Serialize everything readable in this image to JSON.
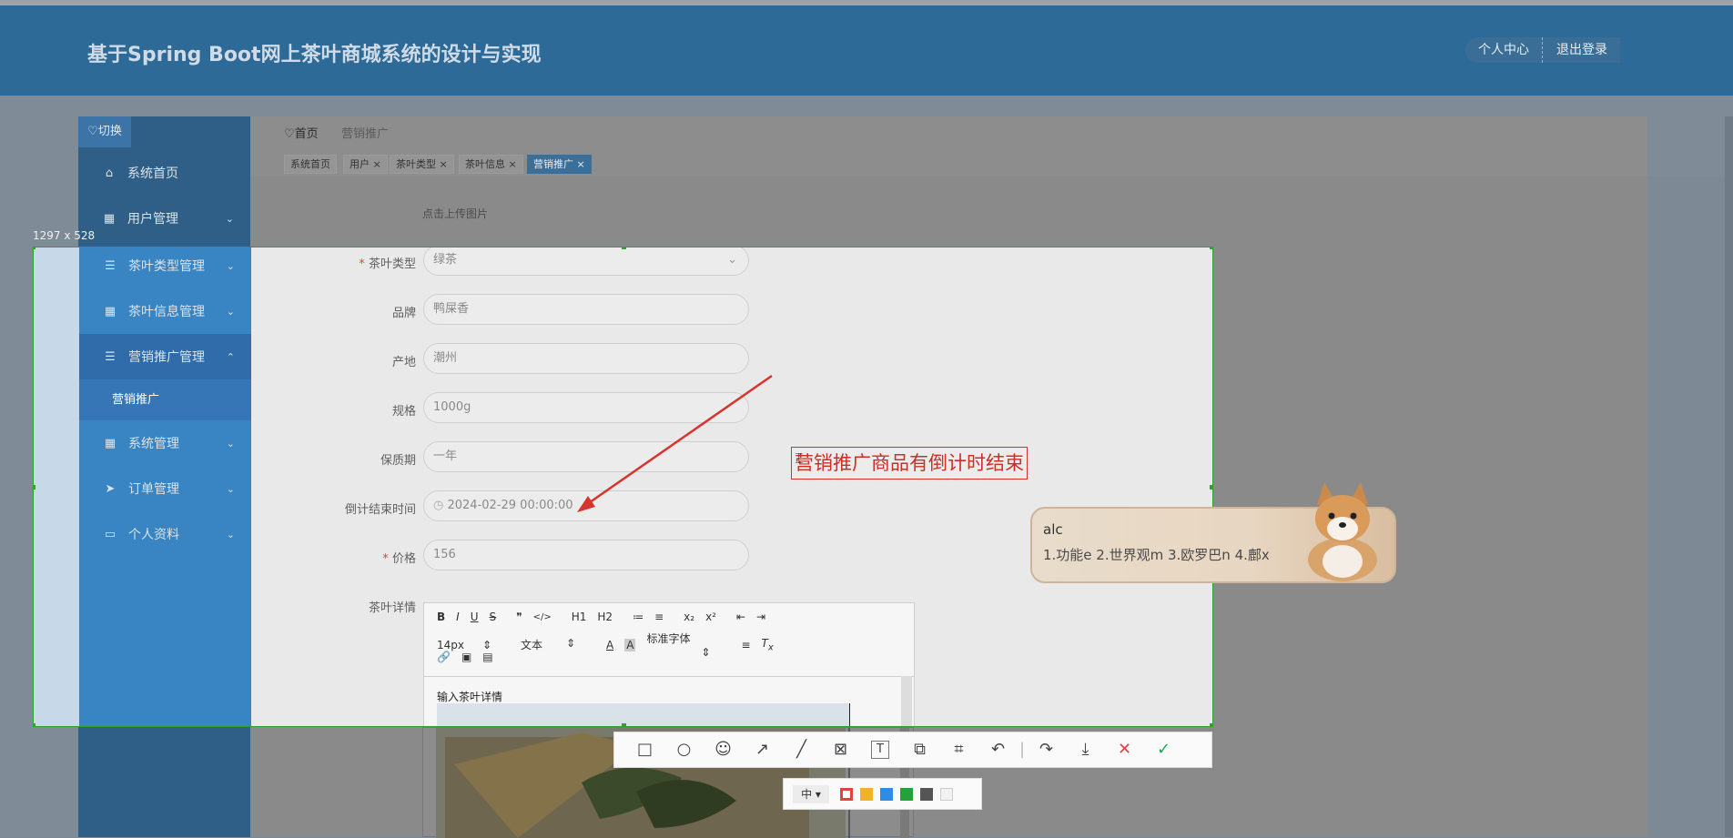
{
  "header": {
    "title": "基于Spring Boot网上茶叶商城系统的设计与实现",
    "personal_center": "个人中心",
    "logout": "退出登录"
  },
  "sidebar": {
    "toggle": "♡切换",
    "items": [
      {
        "label": "系统首页",
        "icon": "home-icon"
      },
      {
        "label": "用户管理",
        "icon": "grid-icon"
      },
      {
        "label": "茶叶类型管理",
        "icon": "list-icon"
      },
      {
        "label": "茶叶信息管理",
        "icon": "grid-icon"
      },
      {
        "label": "营销推广管理",
        "icon": "list-icon"
      },
      {
        "label": "系统管理",
        "icon": "apps-icon"
      },
      {
        "label": "订单管理",
        "icon": "send-icon"
      },
      {
        "label": "个人资料",
        "icon": "card-icon"
      }
    ],
    "sub_item": "营销推广"
  },
  "breadcrumb": {
    "home": "♡首页",
    "current": "营销推广"
  },
  "tabs": [
    "系统首页",
    "用户",
    "茶叶类型",
    "茶叶信息",
    "营销推广"
  ],
  "form": {
    "upload_hint": "点击上传图片",
    "fields": [
      {
        "label": "茶叶类型",
        "value": "绿茶",
        "required": true
      },
      {
        "label": "品牌",
        "value": "鸭屎香",
        "required": false
      },
      {
        "label": "产地",
        "value": "潮州",
        "required": false
      },
      {
        "label": "规格",
        "value": "1000g",
        "required": false
      },
      {
        "label": "保质期",
        "value": "一年",
        "required": false
      },
      {
        "label": "倒计结束时间",
        "value": "2024-02-29 00:00:00",
        "required": false
      },
      {
        "label": "价格",
        "value": "156",
        "required": true
      }
    ],
    "detail_label": "茶叶详情",
    "editor": {
      "toolbar_row1": [
        "B",
        "I",
        "U",
        "S",
        "❞",
        "</>",
        "H1",
        "H2",
        "≔",
        "≡",
        "x₂",
        "x²",
        "⇤",
        "⇥"
      ],
      "font_size": "14px",
      "text_type": "文本",
      "font_family": "标准字体",
      "placeholder_text": "输入茶叶详情"
    }
  },
  "screenshot": {
    "size_label": "1297 x 528",
    "annotation_text": "营销推广商品有倒计时结束",
    "ime_input": "alc",
    "ime_candidates": "1.功能e  2.世界观m  3.欧罗巴n  4.鄜x",
    "toolbar_icons": [
      "rect-icon",
      "circle-icon",
      "emoji-icon",
      "arrow-icon",
      "line-icon",
      "mosaic-icon",
      "text-icon",
      "copy-icon",
      "ocr-icon",
      "undo-icon",
      "redo-icon",
      "download-icon",
      "close-icon",
      "confirm-icon"
    ],
    "size_option": "中",
    "colors": [
      "#e0443e",
      "#f0b428",
      "#2f8ce6",
      "#21a33a",
      "#555555",
      "#f2f2f2"
    ]
  }
}
